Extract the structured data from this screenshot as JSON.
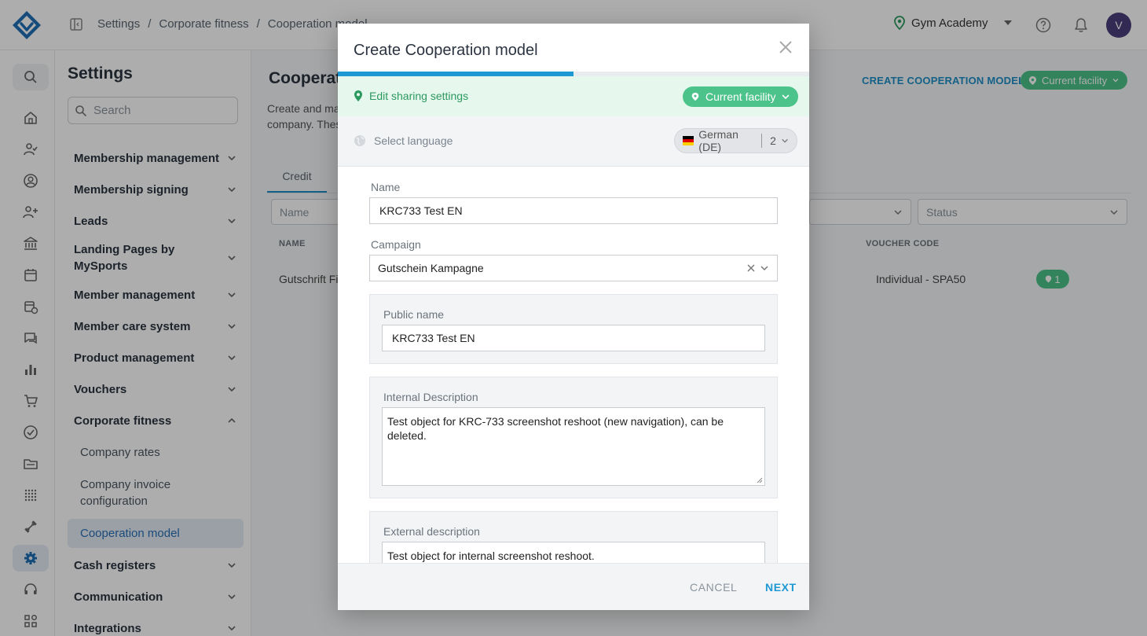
{
  "header": {
    "breadcrumb": [
      "Settings",
      "Corporate fitness",
      "Cooperation model"
    ],
    "facility_name": "Gym Academy",
    "avatar_initial": "V"
  },
  "settings": {
    "title": "Settings",
    "search_placeholder": "Search",
    "menu": [
      {
        "label": "Membership management"
      },
      {
        "label": "Membership signing"
      },
      {
        "label": "Leads"
      },
      {
        "label": "Landing Pages by MySports"
      },
      {
        "label": "Member management"
      },
      {
        "label": "Member care system"
      },
      {
        "label": "Product management"
      },
      {
        "label": "Vouchers"
      },
      {
        "label": "Corporate fitness"
      },
      {
        "label": "Cash registers"
      },
      {
        "label": "Communication"
      },
      {
        "label": "Integrations"
      }
    ],
    "sub_items": [
      "Company rates",
      "Company invoice configuration",
      "Cooperation model"
    ]
  },
  "main": {
    "title": "Cooperat",
    "description_line1": "Create and mar",
    "description_line2": "company. Thes",
    "create_link": "CREATE COOPERATION MODEL",
    "facility_filter": "Current facility",
    "tab": "Credit",
    "filter_name_placeholder": "Name",
    "filter_status_placeholder": "Status",
    "columns": {
      "name": "NAME",
      "voucher_code": "VOUCHER CODE"
    },
    "row": {
      "name": "Gutschrift Fir",
      "voucher": "Individual - SPA50",
      "badge": "1"
    }
  },
  "modal": {
    "title": "Create Cooperation model",
    "progress": 0.5,
    "sharing_label": "Edit sharing settings",
    "facility_pill": "Current facility",
    "language_label": "Select language",
    "language_selected": "German (DE)",
    "language_count": "2",
    "name_label": "Name",
    "name_value": "KRC733 Test EN",
    "campaign_label": "Campaign",
    "campaign_value": "Gutschein Kampagne",
    "public_name_label": "Public name",
    "public_name_value": "KRC733 Test EN",
    "internal_desc_label": "Internal Description",
    "internal_desc_value": "Test object for KRC-733 screenshot reshoot (new navigation), can be deleted.",
    "external_desc_label": "External description",
    "external_desc_value": "Test object for internal screenshot reshoot.",
    "cancel_label": "CANCEL",
    "next_label": "NEXT"
  },
  "colors": {
    "accent": "#1e98d2",
    "success": "#4cc38a",
    "success_text": "#2c9a5e"
  }
}
